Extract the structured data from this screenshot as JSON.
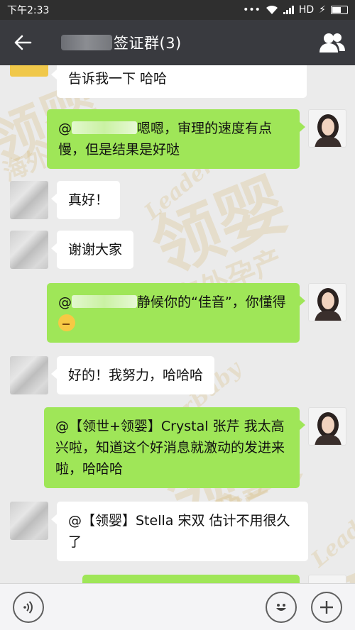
{
  "status_bar": {
    "time": "下午2:33",
    "network": "HD"
  },
  "title_bar": {
    "title": "签证群(3)"
  },
  "messages": [
    {
      "text": "告诉我一下 哈哈"
    },
    {
      "prefix": "@",
      "text": "嗯嗯，审理的速度有点慢，但是结果是好哒"
    },
    {
      "text": "真好！"
    },
    {
      "text": "谢谢大家"
    },
    {
      "prefix": "@",
      "text": "静候你的“佳音”，你懂得"
    },
    {
      "text": "好的！我努力，哈哈哈"
    },
    {
      "text": "@【领世+领婴】Crystal 张芹 我太高兴啦，知道这个好消息就激动的发进来啦，哈哈哈"
    },
    {
      "text": "@【领婴】Stella 宋双 估计不用很久了"
    }
  ],
  "watermark": {
    "big": "领婴",
    "small": "海外孕产",
    "brand": "LeaderBaby"
  },
  "colors": {
    "titlebar": "#393a3f",
    "my_bubble": "#9fe658",
    "chat_bg": "#ebebeb"
  }
}
